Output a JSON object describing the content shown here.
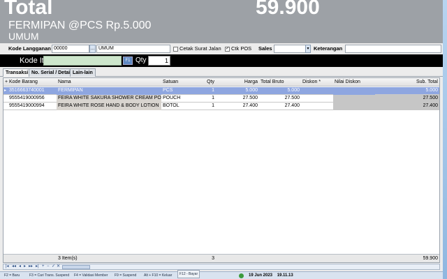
{
  "display": {
    "total_label": "Total",
    "total_value": "59.900",
    "item_desc": "FERMIPAN @PCS Rp.5.000",
    "customer_name": "UMUM"
  },
  "customer": {
    "kode_label": "Kode Langganan",
    "kode_value": "00000",
    "name_value": "UMUM",
    "cetak_label": "Cetak Surat Jalan",
    "cetak_checked": false,
    "ctk_pos_label": "Ctk POS",
    "ctk_pos_checked": true,
    "sales_label": "Sales",
    "sales_value": "",
    "keterangan_label": "Keterangan",
    "keterangan_value": ""
  },
  "item_entry": {
    "kode_label": "Kode Item",
    "kode_value": "",
    "lookup_btn": "F1",
    "qty_label": "Qty",
    "qty_value": "1"
  },
  "tabs": [
    {
      "label": "Transaksi"
    },
    {
      "label": "No. Serial / Detail"
    },
    {
      "label": "Lain-lain"
    }
  ],
  "grid": {
    "headers": [
      "Kode Barang",
      "Nama",
      "Satuan",
      "Qty",
      "Harga",
      "Total Bruto",
      "Diskon *",
      "Nilai Diskon",
      "Sub. Total"
    ],
    "rows": [
      {
        "kode": "3516663740001",
        "nama": "FERMIPAN",
        "satuan": "PCS",
        "qty": "1",
        "harga": "5.000",
        "bruto": "5.000",
        "diskon": "",
        "nilai": "",
        "sub": "5.000"
      },
      {
        "kode": "9555419000956",
        "nama": "FEIRA WHITE SAKURA SHOWER CREAM POUCH",
        "satuan": "POUCH",
        "qty": "1",
        "harga": "27.500",
        "bruto": "27.500",
        "diskon": "",
        "nilai": "",
        "sub": "27.500"
      },
      {
        "kode": "9555419000994",
        "nama": "FEIRA WHITE ROSE HAND & BODY LOTION",
        "satuan": "BOTOL",
        "qty": "1",
        "harga": "27.400",
        "bruto": "27.400",
        "diskon": "",
        "nilai": "",
        "sub": "27.400"
      }
    ],
    "footer": {
      "items": "3 Item(s)",
      "qty": "3",
      "subtotal": "59.900"
    }
  },
  "status_bar": {
    "buttons": [
      "F2 = Baru",
      "F3 = Cari Trans. Suspend",
      "F4 = Validasi Member",
      "F9 = Suspend",
      "Alt + F10 = Keluar"
    ],
    "popup_button": "F12 - Bayar",
    "date": "19 Jun 2023",
    "time": "19.11.13"
  }
}
